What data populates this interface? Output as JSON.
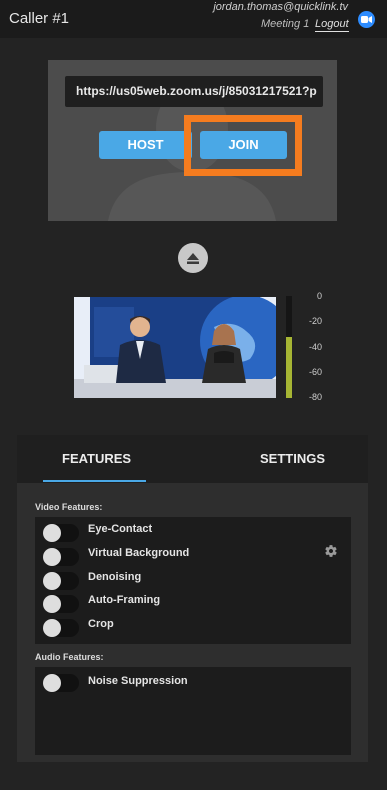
{
  "header": {
    "title": "Caller #1",
    "user_email": "jordan.thomas@quicklink.tv",
    "meeting_name": "Meeting 1",
    "logout_label": "Logout",
    "icon": "zoom-video-icon"
  },
  "join_panel": {
    "meeting_url": "https://us05web.zoom.us/j/85031217521?p",
    "host_label": "HOST",
    "join_label": "JOIN"
  },
  "eject_icon": "eject-icon",
  "audio_meter": {
    "scale_labels": [
      "0",
      "-20",
      "-40",
      "-60",
      "-80"
    ],
    "level": 0.6,
    "color": "#a6b534"
  },
  "tabs": {
    "features_label": "FEATURES",
    "settings_label": "SETTINGS",
    "active": "FEATURES"
  },
  "video_features": {
    "section_label": "Video Features:",
    "items": [
      {
        "label": "Eye-Contact",
        "enabled": false
      },
      {
        "label": "Virtual Background",
        "enabled": false
      },
      {
        "label": "Denoising",
        "enabled": false
      },
      {
        "label": "Auto-Framing",
        "enabled": false
      },
      {
        "label": "Crop",
        "enabled": false
      }
    ]
  },
  "audio_features": {
    "section_label": "Audio Features:",
    "items": [
      {
        "label": "Noise Suppression",
        "enabled": false
      }
    ]
  },
  "colors": {
    "accent": "#4aa8e6",
    "highlight": "#f57c1f",
    "background": "#232323"
  }
}
